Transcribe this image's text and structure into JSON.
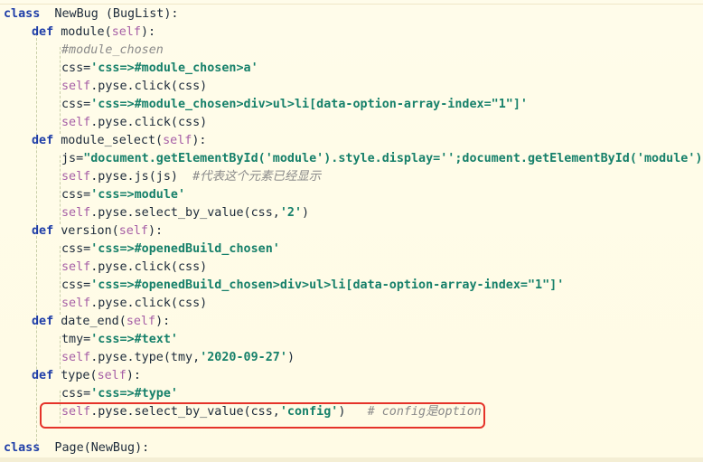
{
  "editor": {
    "guide_color": "#c9cfa8",
    "highlight_color": "#e5332a",
    "lines": {
      "l1": {
        "kw": "class",
        "rest": "  NewBug (BugList):"
      },
      "l2": {
        "kw": "def",
        "name": " module(",
        "self": "self",
        "close": "):"
      },
      "l3": {
        "comment": "#module_chosen"
      },
      "l4": {
        "pre": "css=",
        "str": "'css=>#module_chosen>a'"
      },
      "l5": {
        "self": "self",
        "rest": ".pyse.click(css)"
      },
      "l6": {
        "pre": "css=",
        "str": "'css=>#module_chosen>div>ul>li[data-option-array-index=\"1\"]'"
      },
      "l7": {
        "self": "self",
        "rest": ".pyse.click(css)"
      },
      "l8": {
        "kw": "def",
        "name": " module_select(",
        "self": "self",
        "close": "):"
      },
      "l9": {
        "pre": "js=",
        "str1": "\"document.getElementById(",
        "str2": "'module'",
        "str3": ").style.display=",
        "str4": "''",
        "str5": ";document.getElementById(",
        "str6": "'module'",
        "str7": ")."
      },
      "l10": {
        "self": "self",
        "rest": ".pyse.js(js)  ",
        "comment": "#代表这个元素已经显示"
      },
      "l11": {
        "pre": "css=",
        "str": "'css=>module'"
      },
      "l12": {
        "self": "self",
        "rest1": ".pyse.select_by_value(css,",
        "str": "'2'",
        "rest2": ")"
      },
      "l13": {
        "kw": "def",
        "name": " version(",
        "self": "self",
        "close": "):"
      },
      "l14": {
        "pre": "css=",
        "str": "'css=>#openedBuild_chosen'"
      },
      "l15": {
        "self": "self",
        "rest": ".pyse.click(css)"
      },
      "l16": {
        "pre": "css=",
        "str": "'css=>#openedBuild_chosen>div>ul>li[data-option-array-index=\"1\"]'"
      },
      "l17": {
        "self": "self",
        "rest": ".pyse.click(css)"
      },
      "l18": {
        "kw": "def",
        "name": " date_end(",
        "self": "self",
        "close": "):"
      },
      "l19": {
        "pre": "tmy=",
        "str": "'css=>#text'"
      },
      "l20": {
        "self": "self",
        "rest1": ".pyse.type(tmy,",
        "str": "'2020-09-27'",
        "rest2": ")"
      },
      "l21": {
        "kw": "def",
        "name": " type(",
        "self": "self",
        "close": "):"
      },
      "l22": {
        "pre": "css=",
        "str": "'css=>#type'"
      },
      "l23": {
        "self": "self",
        "rest1": ".pyse.select_by_value(css,",
        "str": "'config'",
        "rest2": ")   ",
        "comment": "# config是option"
      },
      "l25": {
        "kw": "class",
        "rest": "  Page(NewBug):"
      }
    }
  }
}
